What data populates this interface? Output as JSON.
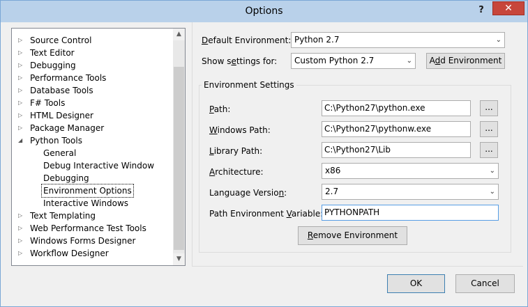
{
  "window": {
    "title": "Options",
    "help_label": "?",
    "close_label": "✕"
  },
  "tree": {
    "items": [
      {
        "label": "Source Control",
        "level": 0,
        "expandable": true
      },
      {
        "label": "Text Editor",
        "level": 0,
        "expandable": true
      },
      {
        "label": "Debugging",
        "level": 0,
        "expandable": true
      },
      {
        "label": "Performance Tools",
        "level": 0,
        "expandable": true
      },
      {
        "label": "Database Tools",
        "level": 0,
        "expandable": true
      },
      {
        "label": "F# Tools",
        "level": 0,
        "expandable": true
      },
      {
        "label": "HTML Designer",
        "level": 0,
        "expandable": true
      },
      {
        "label": "Package Manager",
        "level": 0,
        "expandable": true
      },
      {
        "label": "Python Tools",
        "level": 0,
        "expandable": true,
        "expanded": true
      },
      {
        "label": "General",
        "level": 1,
        "expandable": false
      },
      {
        "label": "Debug Interactive Window",
        "level": 1,
        "expandable": false
      },
      {
        "label": "Debugging",
        "level": 1,
        "expandable": false
      },
      {
        "label": "Environment Options",
        "level": 1,
        "expandable": false,
        "selected": true
      },
      {
        "label": "Interactive Windows",
        "level": 1,
        "expandable": false
      },
      {
        "label": "Text Templating",
        "level": 0,
        "expandable": true
      },
      {
        "label": "Web Performance Test Tools",
        "level": 0,
        "expandable": true
      },
      {
        "label": "Windows Forms Designer",
        "level": 0,
        "expandable": true
      },
      {
        "label": "Workflow Designer",
        "level": 0,
        "expandable": true
      }
    ],
    "arrow_collapsed": "▷",
    "arrow_expanded": "◢",
    "scroll_up": "▲",
    "scroll_down": "▼"
  },
  "settings": {
    "default_env": {
      "label_pre": "",
      "label_u": "D",
      "label_post": "efault Environment:",
      "value": "Python 2.7"
    },
    "show_for": {
      "label_pre": "Show s",
      "label_u": "e",
      "label_post": "ttings for:",
      "value": "Custom Python 2.7"
    },
    "add_env": {
      "label_pre": "A",
      "label_u": "d",
      "label_post": "d Environment"
    },
    "group_title": "Environment Settings",
    "path": {
      "label_pre": "",
      "label_u": "P",
      "label_post": "ath:",
      "value": "C:\\Python27\\python.exe"
    },
    "windows_path": {
      "label_pre": "",
      "label_u": "W",
      "label_post": "indows Path:",
      "value": "C:\\Python27\\pythonw.exe"
    },
    "library_path": {
      "label_pre": "",
      "label_u": "L",
      "label_post": "ibrary Path:",
      "value": "C:\\Python27\\Lib"
    },
    "architecture": {
      "label_pre": "",
      "label_u": "A",
      "label_post": "rchitecture:",
      "value": "x86"
    },
    "language_version": {
      "label_pre": "Language Versio",
      "label_u": "n",
      "label_post": ":",
      "value": "2.7"
    },
    "path_env_var": {
      "label_pre": "Path Environment ",
      "label_u": "V",
      "label_post": "ariable:",
      "value": "PYTHONPATH"
    },
    "browse_label": "...",
    "combo_arrow": "⌄",
    "remove_env": {
      "label_pre": "",
      "label_u": "R",
      "label_post": "emove Environment"
    }
  },
  "footer": {
    "ok_label": "OK",
    "cancel_label": "Cancel"
  }
}
